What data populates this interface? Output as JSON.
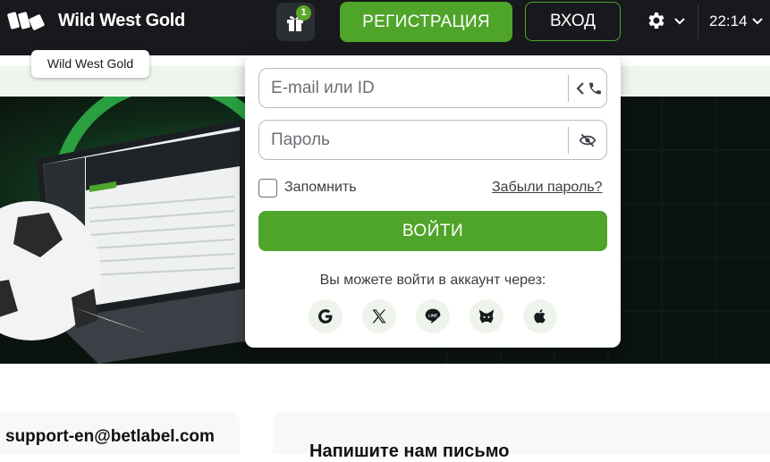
{
  "header": {
    "brand": "Wild West Gold",
    "gift_badge": "1",
    "register_label": "РЕГИСТРАЦИЯ",
    "login_label": "ВХОД",
    "time": "22:14"
  },
  "tooltip": {
    "text": "Wild West Gold"
  },
  "login_form": {
    "email_placeholder": "E-mail или ID",
    "password_placeholder": "Пароль",
    "remember_label": "Запомнить",
    "forgot_label": "Забыли пароль?",
    "submit_label": "ВОЙТИ",
    "social_prompt": "Вы можете войти в аккаунт через:",
    "social_providers": [
      "google-icon",
      "x-icon",
      "line-icon",
      "metamask-icon",
      "apple-icon"
    ]
  },
  "footer": {
    "support_email": "support-en@betlabel.com",
    "mail_title": "Напишите нам письмо"
  },
  "colors": {
    "accent": "#4fa42a",
    "topbar": "#17191c"
  }
}
